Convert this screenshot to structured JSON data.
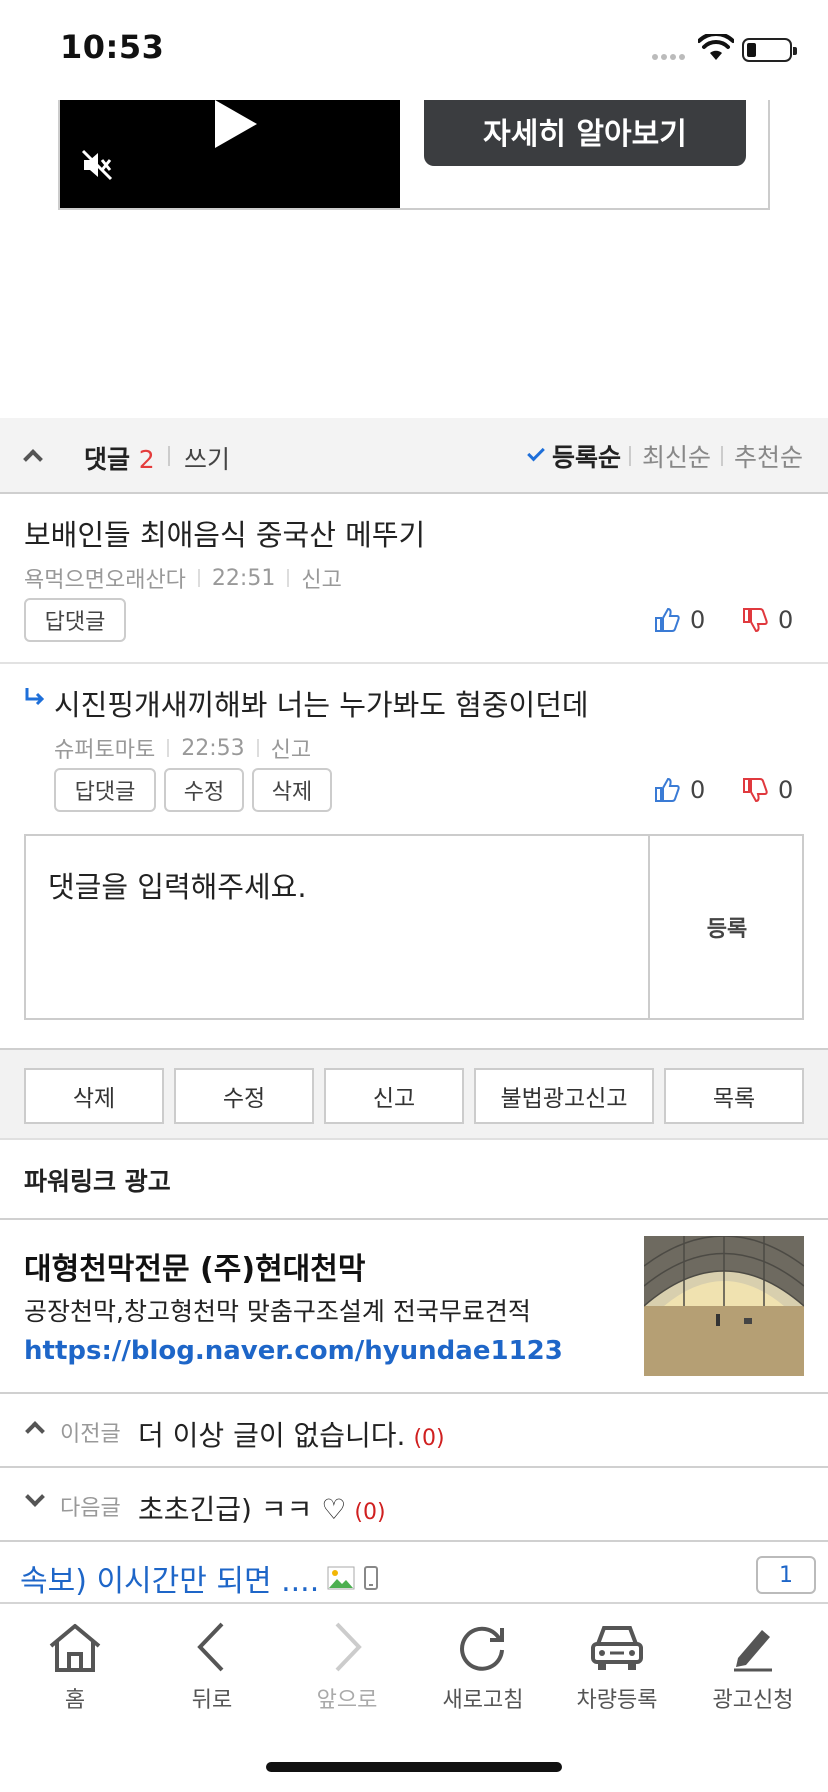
{
  "status": {
    "time": "10:53"
  },
  "ad_video": {
    "cta_label": "자세히 알아보기"
  },
  "comments_header": {
    "label": "댓글",
    "count": "2",
    "write": "쓰기",
    "sort": [
      "등록순",
      "최신순",
      "추천순"
    ]
  },
  "comments": [
    {
      "text": "보배인들 최애음식 중국산 메뚜기",
      "author": "욕먹으면오래산다",
      "time": "22:51",
      "report": "신고",
      "buttons": [
        "답댓글"
      ],
      "likes": "0",
      "dislikes": "0"
    },
    {
      "text": "시진핑개새끼해봐 너는 누가봐도 혐중이던데",
      "author": "슈퍼토마토",
      "time": "22:53",
      "report": "신고",
      "buttons": [
        "답댓글",
        "수정",
        "삭제"
      ],
      "likes": "0",
      "dislikes": "0"
    }
  ],
  "comment_input": {
    "placeholder": "댓글을 입력해주세요.",
    "submit": "등록"
  },
  "actions": [
    "삭제",
    "수정",
    "신고",
    "불법광고신고",
    "목록"
  ],
  "powerlink": {
    "title": "파워링크 광고",
    "ad_title": "대형천막전문 (주)현대천막",
    "ad_desc": "공장천막,창고형천막 맞춤구조설계 전국무료견적",
    "ad_url": "https://blog.naver.com/hyundae1123"
  },
  "prev_post": {
    "label": "이전글",
    "title": "더 이상 글이 없습니다.",
    "count": "(0)"
  },
  "next_post": {
    "label": "다음글",
    "title": "초초긴급) ㅋㅋ ♡",
    "count": "(0)"
  },
  "breaking": {
    "text": "속보) 이시간만 되면 ....",
    "page": "1"
  },
  "toolbar": {
    "items": [
      "홈",
      "뒤로",
      "앞으로",
      "새로고침",
      "차량등록",
      "광고신청"
    ]
  },
  "colors": {
    "link": "#1e66c8",
    "count_red": "#e43c3c",
    "like_blue": "#3a7bd5",
    "dislike_red": "#e0393e"
  }
}
